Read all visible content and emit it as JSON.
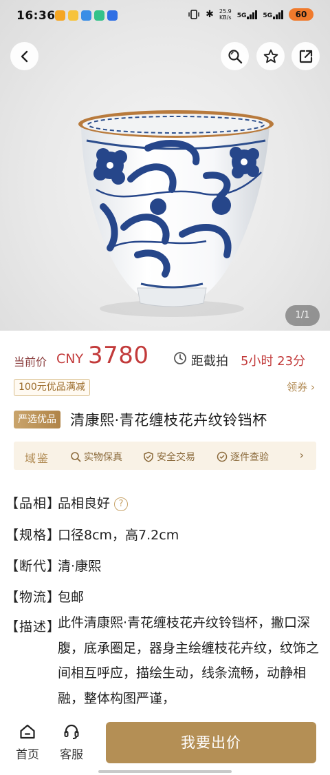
{
  "status_bar": {
    "time": "16:36",
    "network_speed": "25.9",
    "network_speed_unit": "KB/s",
    "signal_1": "5G",
    "signal_2": "5G",
    "battery": "60"
  },
  "header": {
    "back_icon": "back-arrow-icon",
    "search_icon": "search-icon",
    "favorite_icon": "star-icon",
    "share_icon": "share-icon"
  },
  "gallery": {
    "counter": "1/1"
  },
  "price": {
    "label": "当前价",
    "currency": "CNY",
    "value": "3780",
    "countdown_label": "距截拍",
    "countdown": "5小时 23分"
  },
  "coupon": {
    "tag": "100元优品满减",
    "link": "领券"
  },
  "product": {
    "badge": "严选优品",
    "title": "清康熙·青花缠枝花卉纹铃铛杯"
  },
  "guarantee": {
    "brand": "域鉴",
    "items": [
      "实物保真",
      "安全交易",
      "逐件查验"
    ]
  },
  "specs": [
    {
      "key": "【品相】",
      "value": "品相良好"
    },
    {
      "key": "【规格】",
      "value": "口径8cm，高7.2cm"
    },
    {
      "key": "【断代】",
      "value": "清·康熙"
    },
    {
      "key": "【物流】",
      "value": "包邮"
    }
  ],
  "description": {
    "key": "【描述】",
    "value": "此件清康熙·青花缠枝花卉纹铃铛杯，撇口深腹，底承圈足，器身主绘缠枝花卉纹，纹饰之间相互呼应，描绘生动，线条流畅，动静相融，整体构图严谨，"
  },
  "bottom_bar": {
    "home": "首页",
    "service": "客服",
    "bid_button": "我要出价"
  },
  "colors": {
    "price_red": "#c23a3a",
    "gold_accent": "#b48f55",
    "guarantee_bg": "#f9f2e6"
  }
}
